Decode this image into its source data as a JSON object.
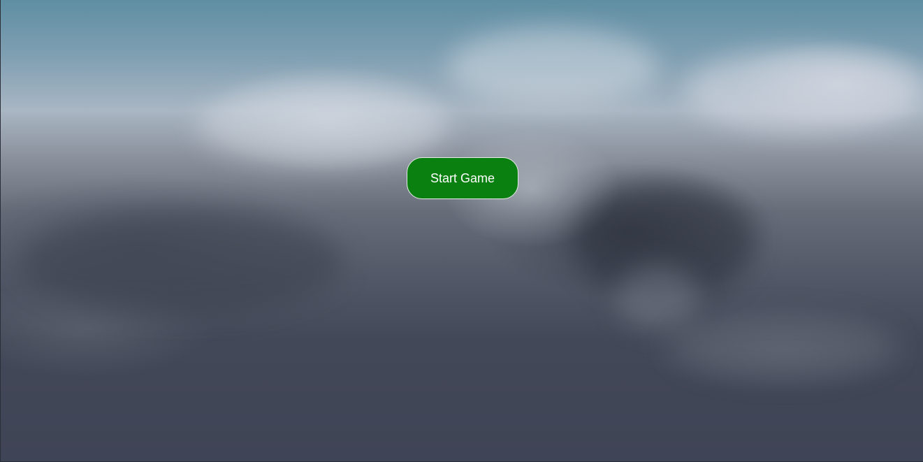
{
  "menu": {
    "start_button_label": "Start Game"
  },
  "colors": {
    "button_fill": "#0a8010",
    "button_text": "#ffffff",
    "sky_top": "#5f8ea3",
    "ground_dark": "#3f4456"
  }
}
